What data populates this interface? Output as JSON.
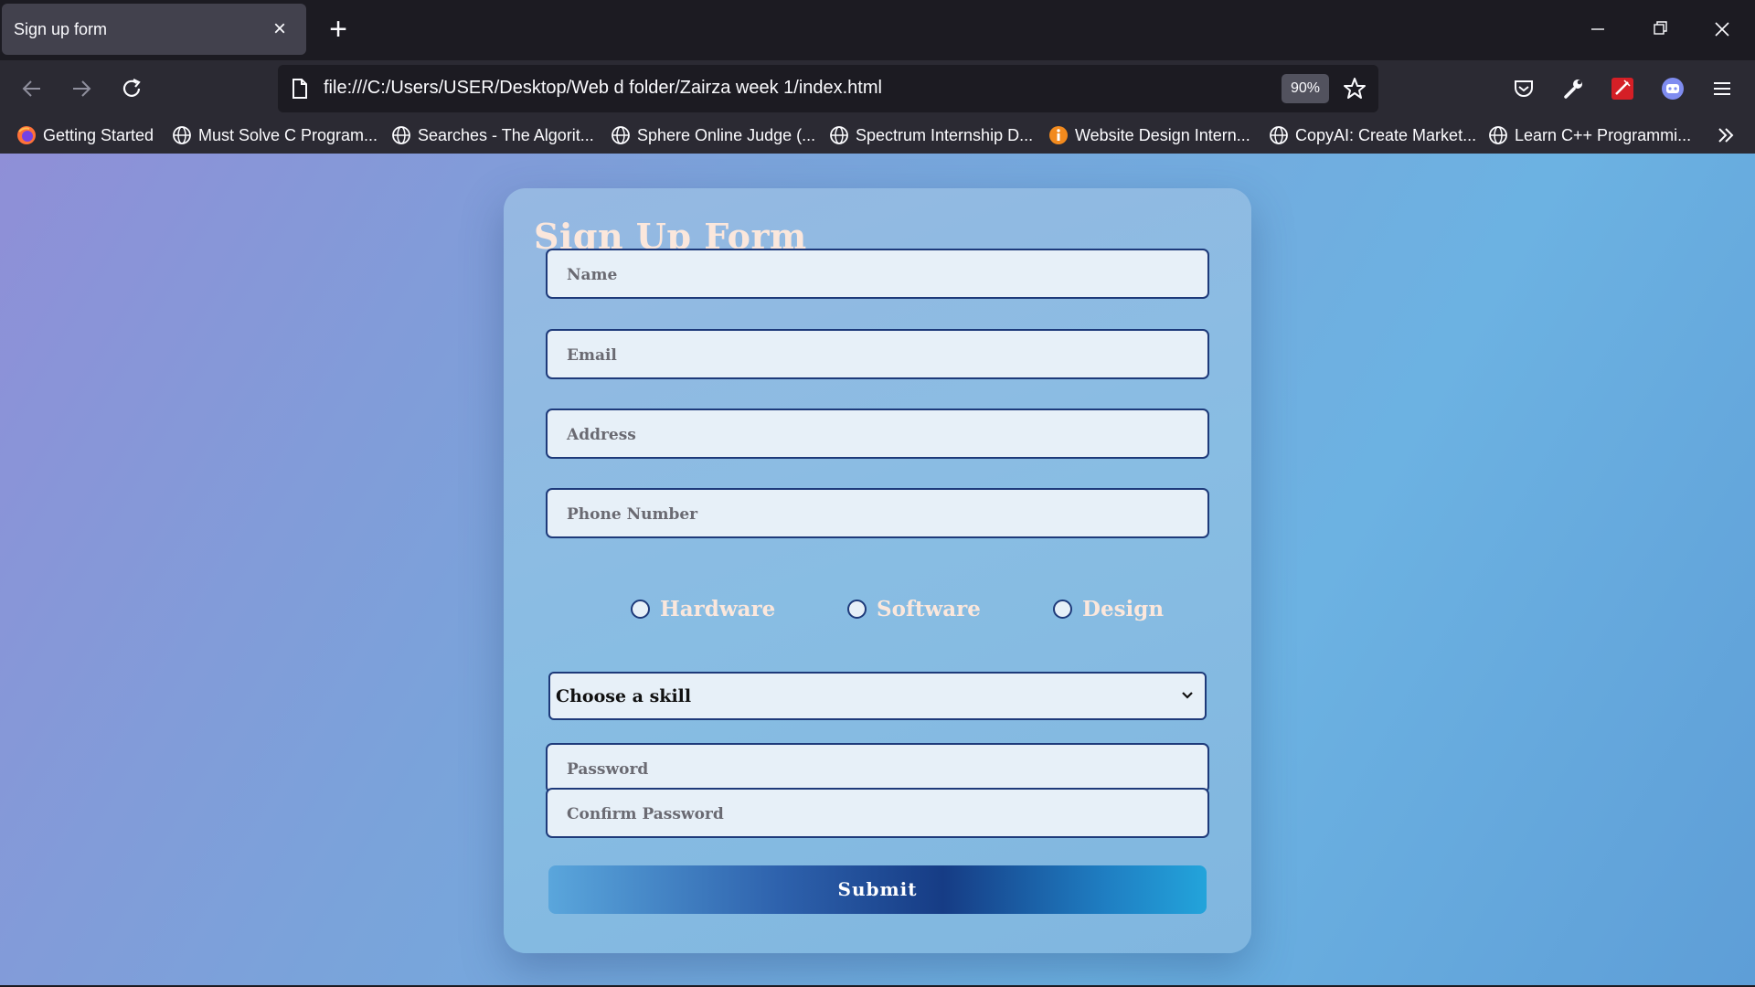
{
  "browser": {
    "tab_title": "Sign up form",
    "url": "file:///C:/Users/USER/Desktop/Web d folder/Zairza week 1/index.html",
    "zoom": "90%",
    "bookmarks": [
      {
        "label": "Getting Started",
        "icon": "firefox-icon"
      },
      {
        "label": "Must Solve C Program...",
        "icon": "globe-icon"
      },
      {
        "label": "Searches - The Algorit...",
        "icon": "globe-icon"
      },
      {
        "label": "Sphere Online Judge (...",
        "icon": "globe-icon"
      },
      {
        "label": "Spectrum Internship D...",
        "icon": "globe-icon"
      },
      {
        "label": "Website Design Intern...",
        "icon": "info-icon"
      },
      {
        "label": "CopyAI: Create Market...",
        "icon": "globe-icon"
      },
      {
        "label": "Learn C++ Programmi...",
        "icon": "globe-icon"
      }
    ]
  },
  "form": {
    "title": "Sign Up Form",
    "fields": {
      "name": "Name",
      "email": "Email",
      "address": "Address",
      "phone": "Phone Number",
      "password": "Password",
      "confirm_password": "Confirm Password"
    },
    "radios": [
      "Hardware",
      "Software",
      "Design"
    ],
    "select_value": "Choose a skill",
    "submit_label": "Submit"
  },
  "colors": {
    "title": "#fbe7dc",
    "field_border": "#1e3a7a",
    "field_bg": "#e7f0f8"
  }
}
